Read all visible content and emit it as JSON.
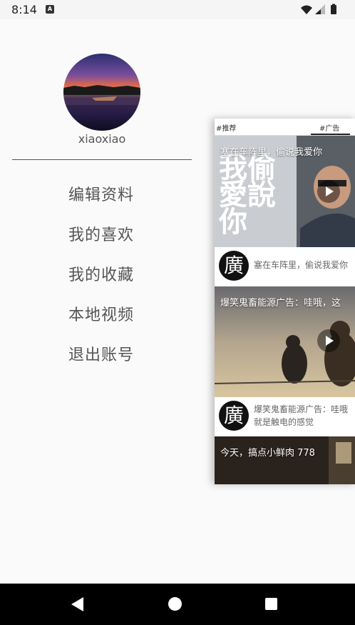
{
  "status_bar": {
    "time": "8:14",
    "notification_icon": "a-badge-icon",
    "notification_glyph": "A",
    "icons": [
      "wifi-icon",
      "signal-icon",
      "battery-icon"
    ]
  },
  "drawer": {
    "username": "xiaoxiao",
    "menu": [
      {
        "label": "编辑资料"
      },
      {
        "label": "我的喜欢"
      },
      {
        "label": "我的收藏"
      },
      {
        "label": "本地视频"
      },
      {
        "label": "退出账号"
      }
    ]
  },
  "main": {
    "tabs": [
      "#推荐",
      "#广告"
    ],
    "selected_tab": "#广告",
    "videos": [
      {
        "title": "塞在车阵里，偷说我爱你",
        "overlay_text": "我偷愛說你",
        "ad_glyph": "廣",
        "description": "塞在车阵里，偷说我爱你"
      },
      {
        "title": "爆笑鬼畜能源广告：哇哦，这",
        "ad_glyph": "廣",
        "description_line1": "爆笑鬼畜能源广告：哇哦",
        "description_line2": "就是触电的感觉"
      },
      {
        "title": "今天，搞点小鲜肉 778"
      }
    ]
  },
  "colors": {
    "background": "#fafafa",
    "menu_text": "#555555",
    "nav_bar": "#000000"
  }
}
